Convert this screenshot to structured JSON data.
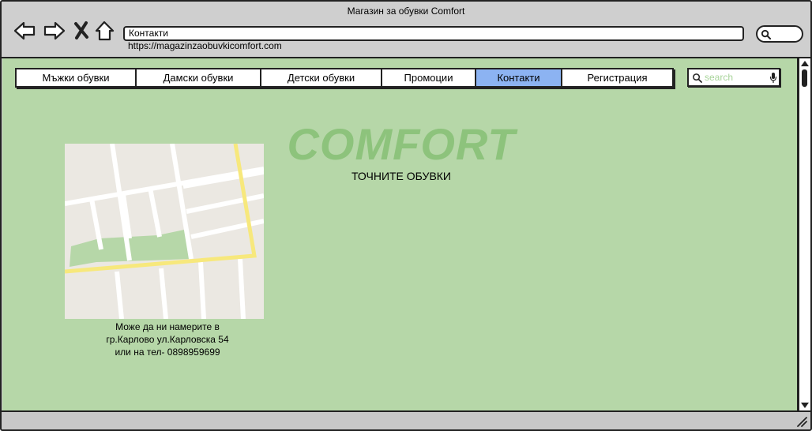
{
  "window": {
    "title": "Магазин за обувки Comfort"
  },
  "browser": {
    "address_value": "Контакти",
    "url": "https://magazinzaobuvkicomfort.com",
    "back_icon": "back-arrow-icon",
    "forward_icon": "forward-arrow-icon",
    "stop_icon": "close-x-icon",
    "home_icon": "home-icon"
  },
  "nav": {
    "items": [
      {
        "label": "Мъжки обувки"
      },
      {
        "label": "Дамски обувки"
      },
      {
        "label": "Детски обувки"
      },
      {
        "label": "Промоции"
      },
      {
        "label": "Контакти",
        "active": true
      },
      {
        "label": "Регистрация"
      }
    ],
    "active_color": "#8cb3f2"
  },
  "search": {
    "placeholder": "search"
  },
  "brand": {
    "name": "COMFORT",
    "tagline": "ТОЧНИТЕ ОБУВКИ",
    "color": "#8dc37c"
  },
  "contact": {
    "line1": "Може да ни намерите в",
    "line2": "гр.Карлово ул.Карловска 54",
    "line3": "или на тел- 0898959699"
  },
  "colors": {
    "page_background": "#b6d7a8",
    "map_road_highlight": "#f7e87c",
    "map_park": "#b6d7a8"
  }
}
